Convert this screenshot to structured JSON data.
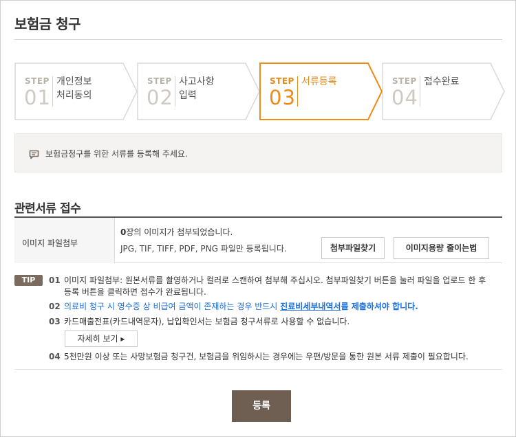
{
  "page": {
    "title": "보험금 청구"
  },
  "steps": [
    {
      "kicker": "STEP",
      "num": "01",
      "label": "개인정보\n처리동의",
      "active": false
    },
    {
      "kicker": "STEP",
      "num": "02",
      "label": "사고사항\n입력",
      "active": false
    },
    {
      "kicker": "STEP",
      "num": "03",
      "label": "서류등록",
      "active": true
    },
    {
      "kicker": "STEP",
      "num": "04",
      "label": "접수완료",
      "active": false
    }
  ],
  "notice": {
    "icon": "speech-bubble-icon",
    "text": "보험금청구를 위한 서류를 등록해 주세요."
  },
  "section": {
    "title": "관련서류 접수"
  },
  "upload": {
    "label": "이미지 파일첨부",
    "count": "0",
    "count_suffix": "장의 이미지가 첨부되었습니다.",
    "formats": "JPG, TIF, TIFF, PDF, PNG 파일만 등록됩니다.",
    "find_button": "첨부파일찾기",
    "reduce_button": "이미지용량 줄이는법"
  },
  "tips": {
    "badge": "TIP",
    "items": [
      {
        "num": "01",
        "text": "이미지 파일첨부: 원본서류를 촬영하거나 컬러로 스캔하여 첨부해 주십시오. 첨부파일찾기 버튼을 눌러 파일을 업로드 한 후 등록 버튼을 클릭하면 접수가 완료됩니다."
      },
      {
        "num": "02",
        "text_a": "의료비 청구 시 영수증 상 비급여 금액이 존재하는 경우 반드시 ",
        "text_link": "진료비세부내역서",
        "text_b": "를 제출하셔야 합니다."
      },
      {
        "num": "03",
        "text": "카드매출전표(카드내역문자), 납입확인서는 보험금 청구서류로 사용할 수 없습니다."
      },
      {
        "num": "04",
        "text": "5천만원 이상 또는 사망보험금 청구건, 보험금을 위임하시는 경우에는 우편/방문을 통한 원본 서류 제출이 필요합니다."
      }
    ],
    "detail_button": "자세히 보기 ▸"
  },
  "submit": {
    "label": "등록"
  },
  "colors": {
    "accent": "#ef8a14",
    "brown": "#6e5f52",
    "link": "#1b6fe0"
  }
}
